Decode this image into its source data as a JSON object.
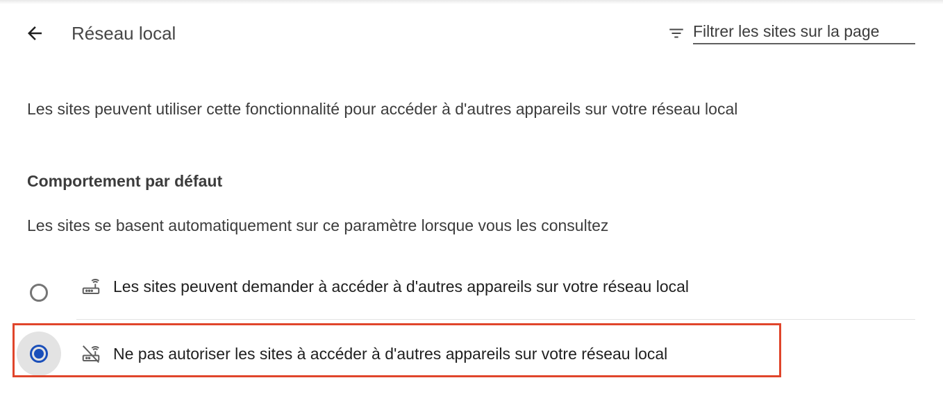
{
  "header": {
    "title": "Réseau local",
    "back_icon": "arrow-back-icon",
    "filter": {
      "icon": "filter-icon",
      "placeholder": "Filtrer les sites sur la page",
      "value": ""
    }
  },
  "description": "Les sites peuvent utiliser cette fonctionnalité pour accéder à d'autres appareils sur votre réseau local",
  "default_behavior": {
    "title": "Comportement par défaut",
    "subtitle": "Les sites se basent automatiquement sur ce paramètre lorsque vous les consultez",
    "options": [
      {
        "label": "Les sites peuvent demander à accéder à d'autres appareils sur votre réseau local",
        "icon": "router-icon",
        "selected": false
      },
      {
        "label": "Ne pas autoriser les sites à accéder à d'autres appareils sur votre réseau local",
        "icon": "router-off-icon",
        "selected": true
      }
    ]
  },
  "colors": {
    "accent": "#1a4fba",
    "highlight": "#e0452b"
  }
}
